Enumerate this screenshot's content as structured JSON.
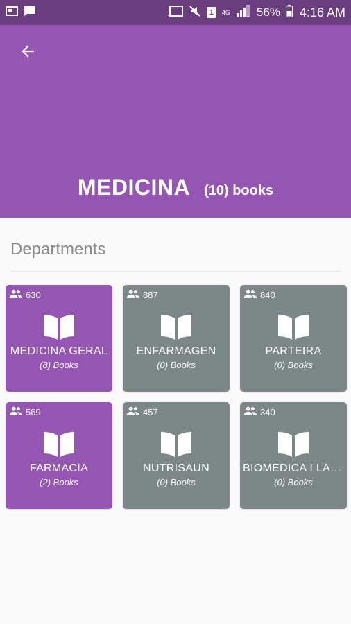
{
  "status_bar": {
    "battery": "56%",
    "time": "4:16 AM",
    "network": "4G",
    "notification_badge": "1",
    "icons": [
      "screenshot-icon",
      "chat-icon",
      "cast-icon",
      "mute-icon",
      "badge-icon",
      "signal-icon",
      "battery-icon"
    ]
  },
  "header": {
    "title": "MEDICINA",
    "book_count": "(10) books",
    "color": "#9555b2",
    "back_icon": "arrow-back-icon"
  },
  "section": {
    "title": "Departments"
  },
  "departments": [
    {
      "name": "MEDICINA GERAL",
      "books": "(8) Books",
      "count": "630",
      "color": "#9555b2"
    },
    {
      "name": "ENFARMAGEN",
      "books": "(0) Books",
      "count": "887",
      "color": "#7c8888"
    },
    {
      "name": "PARTEIRA",
      "books": "(0) Books",
      "count": "840",
      "color": "#7c8888"
    },
    {
      "name": "FARMACIA",
      "books": "(2) Books",
      "count": "569",
      "color": "#9555b2"
    },
    {
      "name": "NUTRISAUN",
      "books": "(0) Books",
      "count": "457",
      "color": "#7c8888"
    },
    {
      "name": "BIOMEDICA I LAB...",
      "books": "(0) Books",
      "count": "340",
      "color": "#7c8888"
    }
  ]
}
